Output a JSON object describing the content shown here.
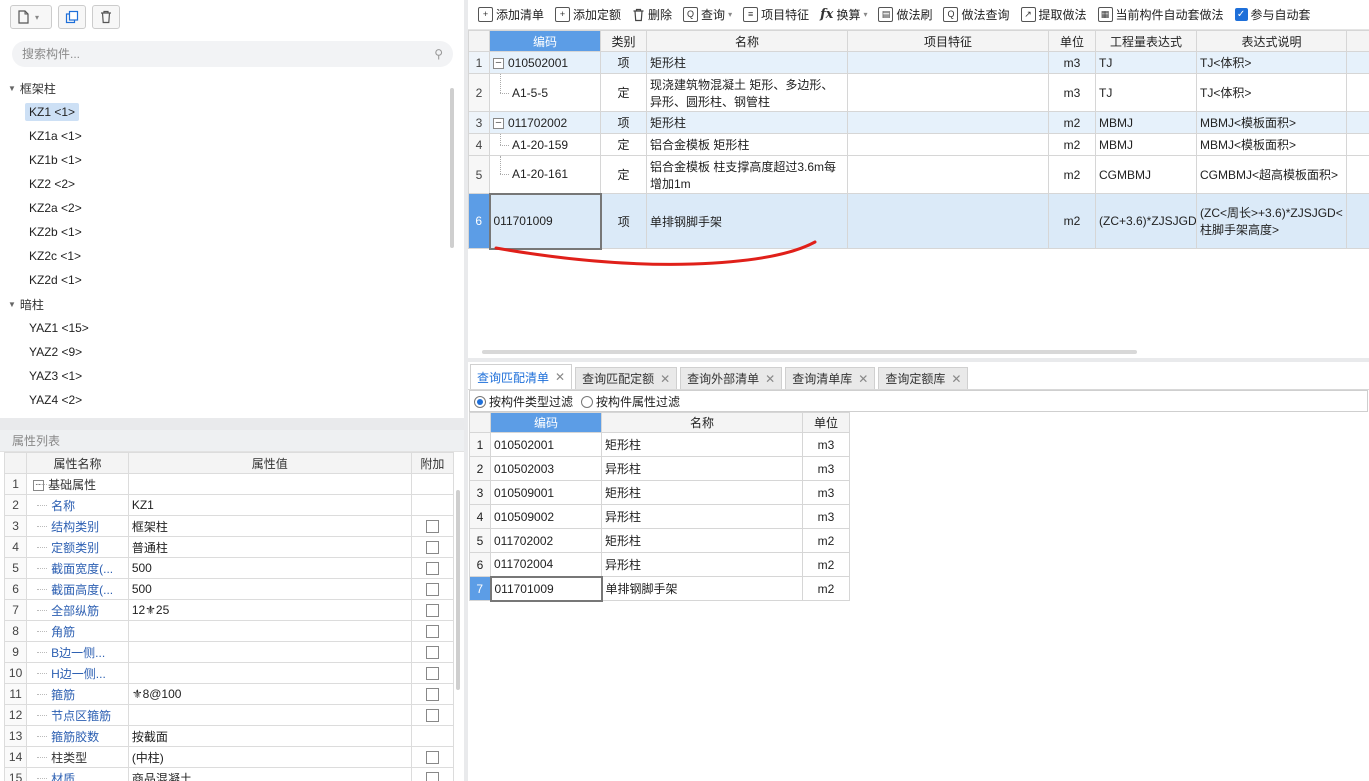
{
  "left_toolbar": {
    "icons": [
      "new-file-icon",
      "copy-icon",
      "delete-icon"
    ]
  },
  "search": {
    "placeholder": "搜索构件..."
  },
  "tree": [
    {
      "group": "框架柱",
      "items": [
        "KZ1 <1>",
        "KZ1a <1>",
        "KZ1b <1>",
        "KZ2 <2>",
        "KZ2a <2>",
        "KZ2b <1>",
        "KZ2c <1>",
        "KZ2d <1>"
      ]
    },
    {
      "group": "暗柱",
      "items": [
        "YAZ1 <15>",
        "YAZ2 <9>",
        "YAZ3 <1>",
        "YAZ4 <2>"
      ]
    }
  ],
  "selected_tree_item": "KZ1 <1>",
  "property_list": {
    "title": "属性列表",
    "headers": [
      "属性名称",
      "属性值",
      "附加"
    ],
    "rows": [
      {
        "no": "1",
        "name": "基础属性",
        "value": "",
        "check": false
      },
      {
        "no": "2",
        "name": "名称",
        "value": "KZ1",
        "check": false
      },
      {
        "no": "3",
        "name": "结构类别",
        "value": "框架柱",
        "check": true
      },
      {
        "no": "4",
        "name": "定额类别",
        "value": "普通柱",
        "check": true
      },
      {
        "no": "5",
        "name": "截面宽度(...",
        "value": "500",
        "check": true
      },
      {
        "no": "6",
        "name": "截面高度(...",
        "value": "500",
        "check": true
      },
      {
        "no": "7",
        "name": "全部纵筋",
        "value": "12⚜25",
        "check": true
      },
      {
        "no": "8",
        "name": "角筋",
        "value": "",
        "check": true
      },
      {
        "no": "9",
        "name": "B边一侧...",
        "value": "",
        "check": true
      },
      {
        "no": "10",
        "name": "H边一侧...",
        "value": "",
        "check": true
      },
      {
        "no": "11",
        "name": "箍筋",
        "value": "⚜8@100",
        "check": true
      },
      {
        "no": "12",
        "name": "节点区箍筋",
        "value": "",
        "check": true
      },
      {
        "no": "13",
        "name": "箍筋胶数",
        "value": "按截面",
        "check": false
      },
      {
        "no": "14",
        "name": "柱类型",
        "value": "(中柱)",
        "check": true
      },
      {
        "no": "15",
        "name": "材质",
        "value": "商品混凝土",
        "check": true
      }
    ]
  },
  "right_toolbar": {
    "add_list": "添加清单",
    "add_quota": "添加定额",
    "delete": "删除",
    "query": "查询",
    "item_feature": "项目特征",
    "convert": "换算",
    "method_brush": "做法刷",
    "method_query": "做法查询",
    "extract_method": "提取做法",
    "auto_method": "当前构件自动套做法",
    "auto_join": "参与自动套"
  },
  "main_grid": {
    "headers": [
      "编码",
      "类别",
      "名称",
      "项目特征",
      "单位",
      "工程量表达式",
      "表达式说明"
    ],
    "rows": [
      {
        "no": "1",
        "code": "010502001",
        "type": "项",
        "name": "矩形柱",
        "feature": "",
        "unit": "m3",
        "expr": "TJ",
        "desc": "TJ<体积>"
      },
      {
        "no": "2",
        "code": "A1-5-5",
        "type": "定",
        "name": "现浇建筑物混凝土 矩形、多边形、异形、圆形柱、钢管柱",
        "feature": "",
        "unit": "m3",
        "expr": "TJ",
        "desc": "TJ<体积>"
      },
      {
        "no": "3",
        "code": "011702002",
        "type": "项",
        "name": "矩形柱",
        "feature": "",
        "unit": "m2",
        "expr": "MBMJ",
        "desc": "MBMJ<模板面积>"
      },
      {
        "no": "4",
        "code": "A1-20-159",
        "type": "定",
        "name": "铝合金模板 矩形柱",
        "feature": "",
        "unit": "m2",
        "expr": "MBMJ",
        "desc": "MBMJ<模板面积>"
      },
      {
        "no": "5",
        "code": "A1-20-161",
        "type": "定",
        "name": "铝合金模板 柱支撑高度超过3.6m每增加1m",
        "feature": "",
        "unit": "m2",
        "expr": "CGMBMJ",
        "desc": "CGMBMJ<超高模板面积>"
      },
      {
        "no": "6",
        "code": "011701009",
        "type": "项",
        "name": "单排钢脚手架",
        "feature": "",
        "unit": "m2",
        "expr": "(ZC+3.6)*ZJSJGD",
        "desc": "(ZC<周长>+3.6)*ZJSJGD<柱脚手架高度>"
      }
    ]
  },
  "bottom_tabs": [
    "查询匹配清单",
    "查询匹配定额",
    "查询外部清单",
    "查询清单库",
    "查询定额库"
  ],
  "filters": [
    "按构件类型过滤",
    "按构件属性过滤"
  ],
  "bottom_grid": {
    "headers": [
      "编码",
      "名称",
      "单位"
    ],
    "rows": [
      {
        "no": "1",
        "code": "010502001",
        "name": "矩形柱",
        "unit": "m3"
      },
      {
        "no": "2",
        "code": "010502003",
        "name": "异形柱",
        "unit": "m3"
      },
      {
        "no": "3",
        "code": "010509001",
        "name": "矩形柱",
        "unit": "m3"
      },
      {
        "no": "4",
        "code": "010509002",
        "name": "异形柱",
        "unit": "m3"
      },
      {
        "no": "5",
        "code": "011702002",
        "name": "矩形柱",
        "unit": "m2"
      },
      {
        "no": "6",
        "code": "011702004",
        "name": "异形柱",
        "unit": "m2"
      },
      {
        "no": "7",
        "code": "011701009",
        "name": "单排钢脚手架",
        "unit": "m2"
      }
    ]
  },
  "colors": {
    "accent": "#1e6fd9",
    "header_blue": "#5c9de6",
    "annotation": "#e0201a"
  }
}
